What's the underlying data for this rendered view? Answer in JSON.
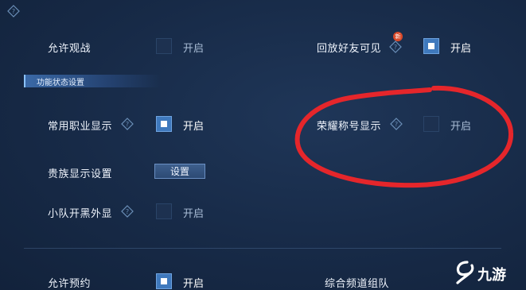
{
  "rows": [
    {
      "label": "允许观战",
      "on_text": "开启",
      "checked": false
    },
    {
      "label": "回放好友可见",
      "on_text": "开启",
      "checked": true,
      "badge": "新"
    },
    {
      "label": "常用职业显示",
      "on_text": "开启",
      "checked": true
    },
    {
      "label": "荣耀称号显示",
      "on_text": "开启",
      "checked": false
    },
    {
      "label": "贵族显示设置",
      "button_label": "设置"
    },
    {
      "label": "小队开黑外显",
      "on_text": "开启",
      "checked": false
    },
    {
      "label": "允许预约",
      "on_text": "开启",
      "checked": true
    },
    {
      "label": "综合频道组队"
    }
  ],
  "section": {
    "title": "功能状态设置"
  },
  "watermark": {
    "text": "九游"
  },
  "annotation": {
    "color": "#e5262b"
  },
  "colors": {
    "checkbox_on": "#3f79bd",
    "background": "#172a47"
  },
  "icons": {
    "help": "help-icon",
    "watermark_logo": "jiuyou-logo-icon"
  }
}
